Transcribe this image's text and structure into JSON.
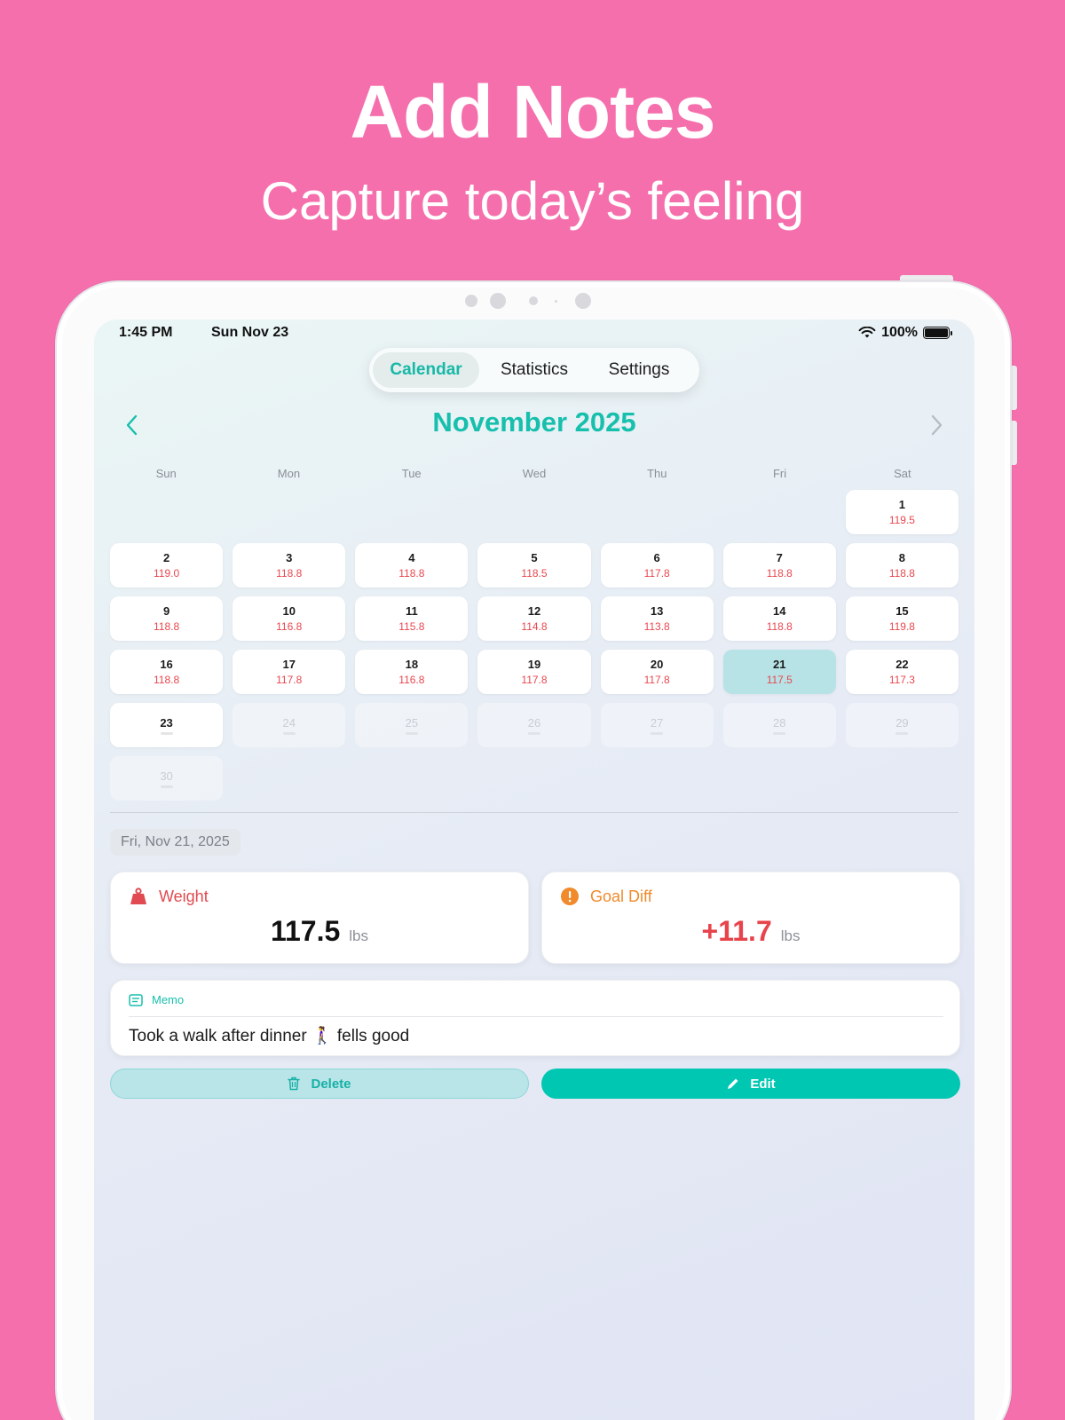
{
  "promo": {
    "title": "Add Notes",
    "subtitle": "Capture today’s feeling"
  },
  "status_bar": {
    "time": "1:45 PM",
    "date": "Sun Nov 23",
    "battery": "100%"
  },
  "tabs": [
    {
      "label": "Calendar",
      "active": true
    },
    {
      "label": "Statistics",
      "active": false
    },
    {
      "label": "Settings",
      "active": false
    }
  ],
  "calendar": {
    "month_title": "November 2025",
    "weekdays": [
      "Sun",
      "Mon",
      "Tue",
      "Wed",
      "Thu",
      "Fri",
      "Sat"
    ],
    "leading_blanks": 6,
    "days": [
      {
        "day": "1",
        "weight": "119.5"
      },
      {
        "day": "2",
        "weight": "119.0"
      },
      {
        "day": "3",
        "weight": "118.8"
      },
      {
        "day": "4",
        "weight": "118.8"
      },
      {
        "day": "5",
        "weight": "118.5"
      },
      {
        "day": "6",
        "weight": "117.8"
      },
      {
        "day": "7",
        "weight": "118.8"
      },
      {
        "day": "8",
        "weight": "118.8"
      },
      {
        "day": "9",
        "weight": "118.8"
      },
      {
        "day": "10",
        "weight": "116.8"
      },
      {
        "day": "11",
        "weight": "115.8"
      },
      {
        "day": "12",
        "weight": "114.8"
      },
      {
        "day": "13",
        "weight": "113.8"
      },
      {
        "day": "14",
        "weight": "118.8"
      },
      {
        "day": "15",
        "weight": "119.8"
      },
      {
        "day": "16",
        "weight": "118.8"
      },
      {
        "day": "17",
        "weight": "117.8"
      },
      {
        "day": "18",
        "weight": "116.8"
      },
      {
        "day": "19",
        "weight": "117.8"
      },
      {
        "day": "20",
        "weight": "117.8"
      },
      {
        "day": "21",
        "weight": "117.5",
        "selected": true
      },
      {
        "day": "22",
        "weight": "117.3"
      },
      {
        "day": "23",
        "weight": "",
        "today": true
      },
      {
        "day": "24",
        "weight": "",
        "future": true
      },
      {
        "day": "25",
        "weight": "",
        "future": true
      },
      {
        "day": "26",
        "weight": "",
        "future": true
      },
      {
        "day": "27",
        "weight": "",
        "future": true
      },
      {
        "day": "28",
        "weight": "",
        "future": true
      },
      {
        "day": "29",
        "weight": "",
        "future": true
      },
      {
        "day": "30",
        "weight": "",
        "future": true
      }
    ]
  },
  "detail": {
    "date_label": "Fri, Nov 21, 2025",
    "weight": {
      "label": "Weight",
      "value": "117.5",
      "unit": "lbs"
    },
    "goal_diff": {
      "label": "Goal Diff",
      "value": "+11.7",
      "unit": "lbs"
    },
    "memo": {
      "label": "Memo",
      "text": "Took a walk after dinner 🚶‍♀️ fells good"
    },
    "delete_label": "Delete",
    "edit_label": "Edit"
  },
  "colors": {
    "background": "#f56fad",
    "accent": "#17bfad",
    "weight_red": "#e8474f",
    "goal_orange": "#f08a2c",
    "selected_day": "#b7e3e6"
  }
}
